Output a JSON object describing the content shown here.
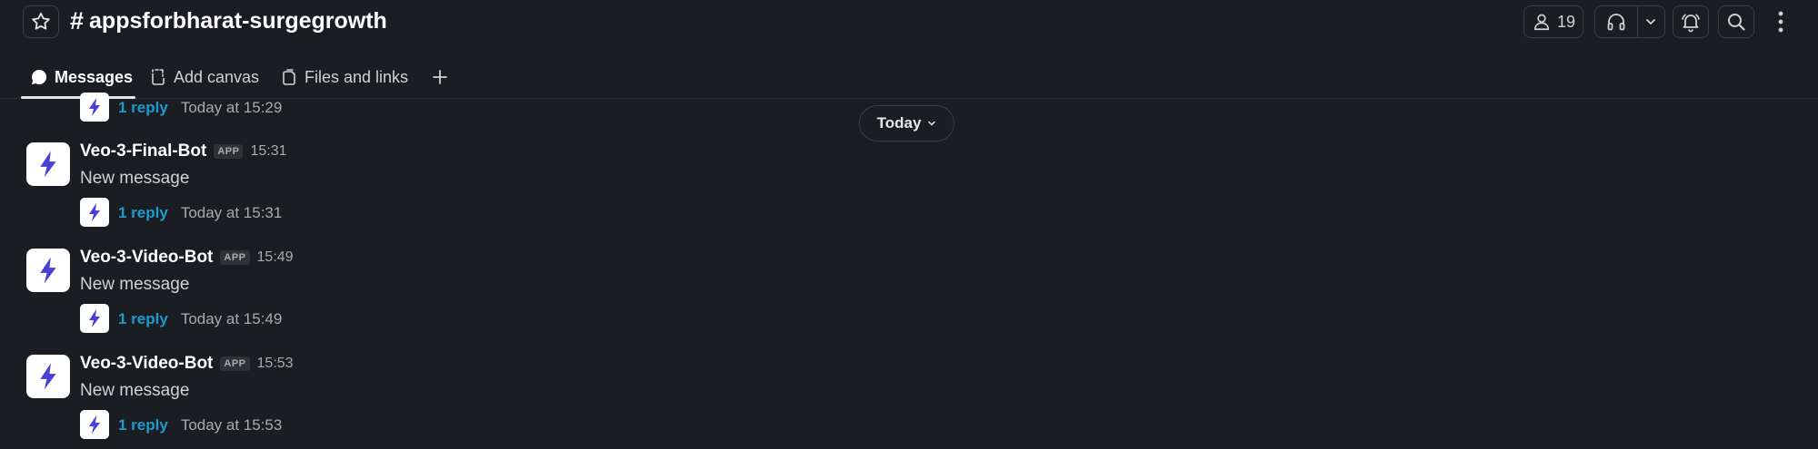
{
  "header": {
    "channel_prefix": "#",
    "channel_name": "appsforbharat-surgegrowth",
    "member_count": "19",
    "icons": {
      "star": "star-icon",
      "members": "person-icon",
      "huddle": "headphones-icon",
      "huddle_menu": "chevron-down-icon",
      "activity": "bell-icon",
      "search": "search-icon",
      "more": "kebab-icon"
    }
  },
  "tabs": [
    {
      "label": "Messages",
      "icon": "message-bubble-icon",
      "active": true
    },
    {
      "label": "Add canvas",
      "icon": "canvas-icon",
      "active": false
    },
    {
      "label": "Files and links",
      "icon": "files-icon",
      "active": false
    }
  ],
  "date_divider": {
    "label": "Today"
  },
  "top_thread": {
    "reply_label": "1 reply",
    "reply_time": "Today at 15:29"
  },
  "messages": [
    {
      "sender": "Veo-3-Final-Bot",
      "badge": "APP",
      "time": "15:31",
      "text": "New message",
      "reply_label": "1 reply",
      "reply_time": "Today at 15:31"
    },
    {
      "sender": "Veo-3-Video-Bot",
      "badge": "APP",
      "time": "15:49",
      "text": "New message",
      "reply_label": "1 reply",
      "reply_time": "Today at 15:49"
    },
    {
      "sender": "Veo-3-Video-Bot",
      "badge": "APP",
      "time": "15:53",
      "text": "New message",
      "reply_label": "1 reply",
      "reply_time": "Today at 15:53"
    }
  ],
  "colors": {
    "background": "#1a1d21",
    "link": "#1d9bd1",
    "bot_bolt": "#4a3fd6"
  }
}
